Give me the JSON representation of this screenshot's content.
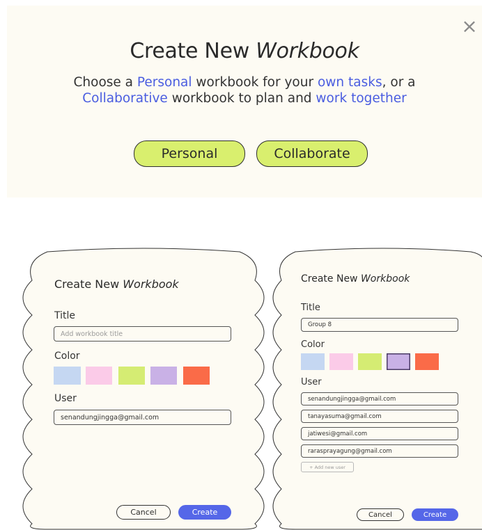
{
  "dialog": {
    "title_main": "Create New",
    "title_ital": "Workbook",
    "subtitle": {
      "p1": "Choose a ",
      "h1": "Personal",
      "p2": " workbook for your ",
      "h2": "own tasks",
      "p3": ", or a",
      "h3": "Collaborative",
      "p4": " workbook to plan and ",
      "h4": "work together"
    },
    "personal_label": "Personal",
    "collaborate_label": "Collaborate",
    "close_glyph": "×"
  },
  "personal_card": {
    "title_main": "Create New ",
    "title_ital": "Workbook",
    "title_label": "Title",
    "title_placeholder": "Add workbook title",
    "color_label": "Color",
    "user_label": "User",
    "user_value": "senandungjingga@gmail.com",
    "cancel_label": "Cancel",
    "create_label": "Create"
  },
  "collab_card": {
    "title_main": "Create New ",
    "title_ital": "Workbook",
    "title_label": "Title",
    "title_value": "Group 8",
    "color_label": "Color",
    "user_label": "User",
    "users": [
      "senandungjingga@gmail.com",
      "tanayasuma@gmail.com",
      "jatiwesi@gmail.com",
      "rarasprayagung@gmail.com"
    ],
    "add_user_label": "+ Add new user",
    "cancel_label": "Cancel",
    "create_label": "Create"
  },
  "colors": {
    "swatches": [
      "#c5d7f2",
      "#fbcbe8",
      "#d5ec73",
      "#c9b1e6",
      "#fa6b48"
    ],
    "accent": "#4a5de0",
    "pill": "#d9ef6e",
    "create_button": "#5567e8",
    "card_bg": "#fdfbf3"
  },
  "icons": {
    "close": "close-icon"
  }
}
